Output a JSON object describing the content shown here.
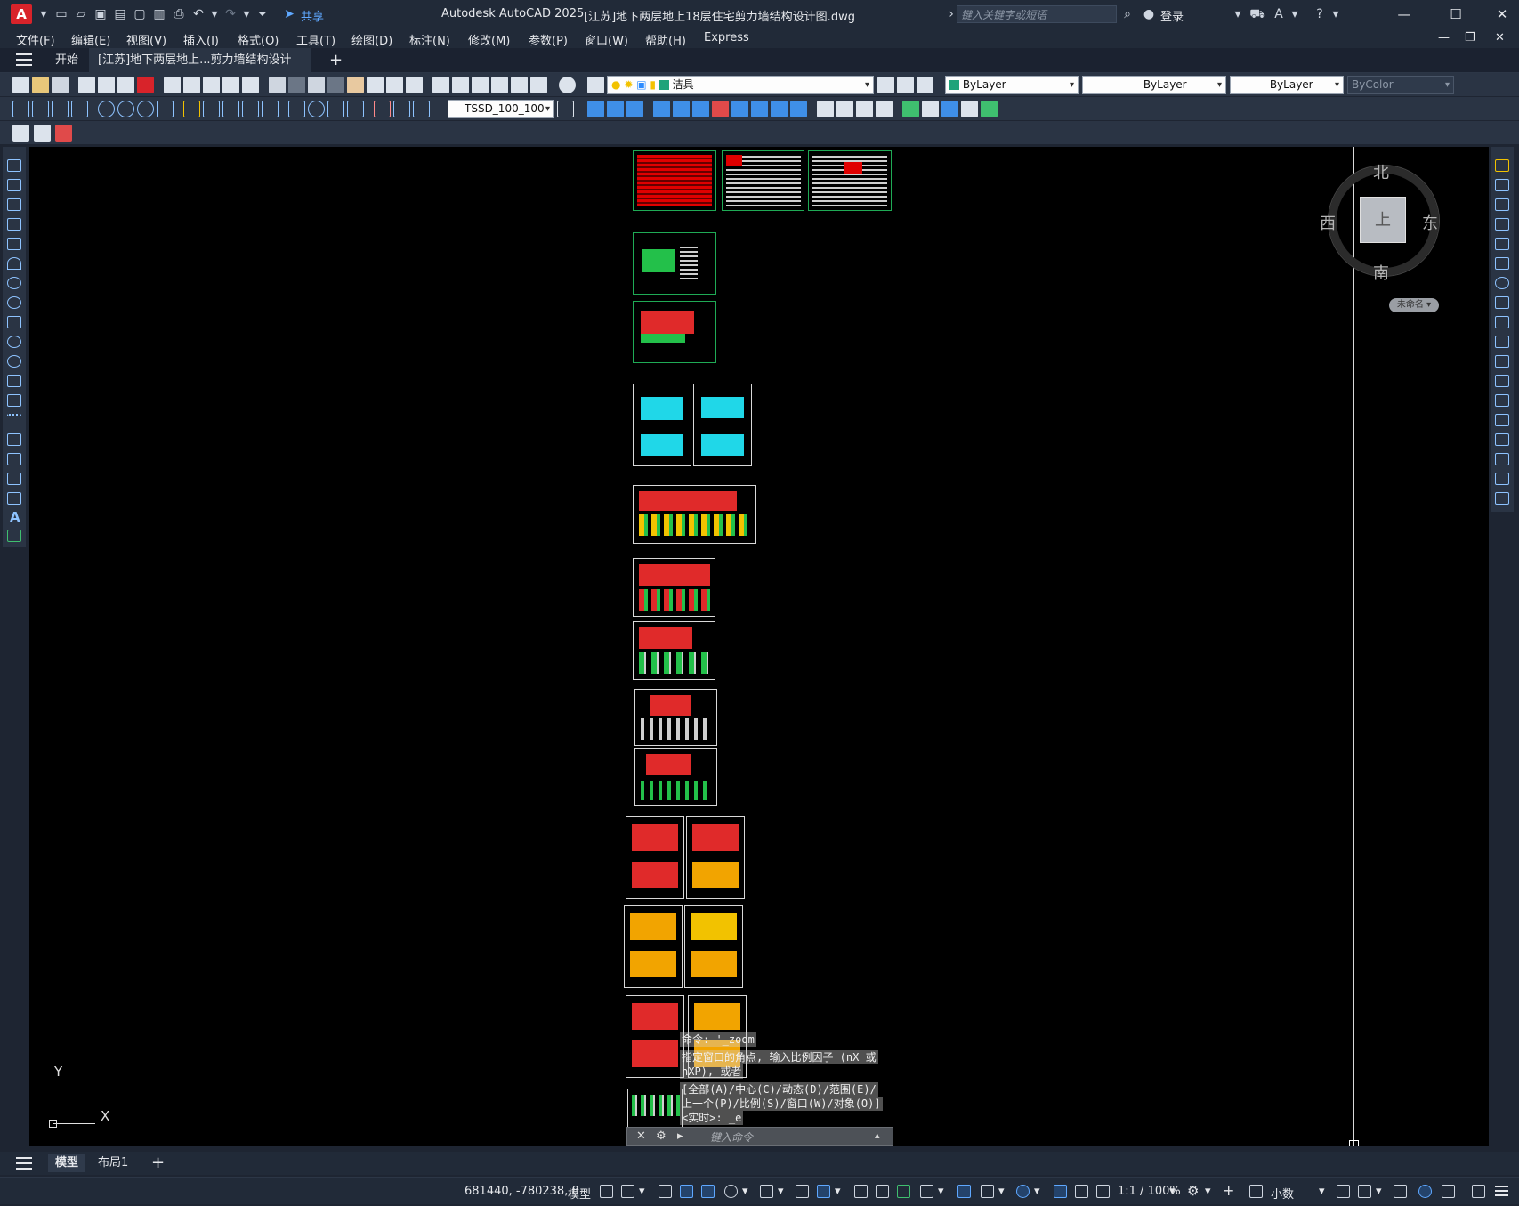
{
  "app": {
    "logo_letter": "A",
    "title": "Autodesk AutoCAD 2025",
    "document_title": "[江苏]地下两层地上18层住宅剪力墙结构设计图.dwg",
    "share_label": "共享",
    "search_placeholder": "键入关键字或短语",
    "login_label": "登录"
  },
  "menu": {
    "items": [
      "文件(F)",
      "编辑(E)",
      "视图(V)",
      "插入(I)",
      "格式(O)",
      "工具(T)",
      "绘图(D)",
      "标注(N)",
      "修改(M)",
      "参数(P)",
      "窗口(W)",
      "帮助(H)",
      "Express"
    ]
  },
  "tabs": {
    "start_label": "开始",
    "document_tab_label": "[江苏]地下两层地上...剪力墙结构设计图*",
    "close_glyph": "✕",
    "add_glyph": "+"
  },
  "properties": {
    "layer_value": "洁具",
    "color_value": "ByLayer",
    "linetype_value": "ByLayer",
    "lineweight_value": "ByLayer",
    "plotstyle_value": "ByColor",
    "dimstyle_value": "TSSD_100_100"
  },
  "viewcube": {
    "north": "北",
    "south": "南",
    "east": "东",
    "west": "西",
    "face": "上",
    "wcs_label": "未命名"
  },
  "ucs": {
    "x_label": "X",
    "y_label": "Y"
  },
  "command": {
    "history_1": "命令: '_zoom",
    "history_2": "指定窗口的角点, 输入比例因子 (nX 或",
    "history_3": "nXP), 或者",
    "history_4": "[全部(A)/中心(C)/动态(D)/范围(E)/",
    "history_5": "上一个(P)/比例(S)/窗口(W)/对象(O)]",
    "history_6": "<实时>: _e",
    "input_placeholder": "键入命令"
  },
  "layout_tabs": {
    "model_label": "模型",
    "layout1_label": "布局1",
    "add_glyph": "+"
  },
  "status": {
    "coordinates": "681440, -780238, 0",
    "space_label": "模型",
    "scale_label": "1:1 / 100%",
    "units_label": "小数"
  },
  "colors": {
    "accent_blue": "#5fa8ff",
    "canvas": "#000000",
    "chrome": "#212a38",
    "toolbar": "#2a3444",
    "layer_swatch": "#1fa37a",
    "logo_red": "#d8232a"
  }
}
